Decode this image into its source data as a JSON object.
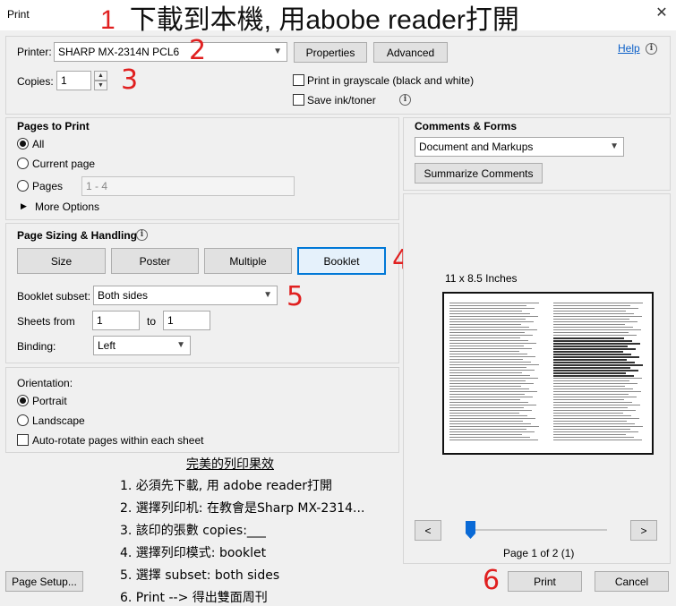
{
  "window": {
    "title": "Print",
    "close_glyph": "✕"
  },
  "annotations": {
    "header_number": "1",
    "header_text": "下載到本機, 用abobe reader打開",
    "n2": "2",
    "n3": "3",
    "n4": "4",
    "n5": "5",
    "n6": "6"
  },
  "printer": {
    "label": "Printer:",
    "selected": "SHARP MX-2314N PCL6",
    "properties_label": "Properties",
    "advanced_label": "Advanced",
    "help_label": "Help",
    "copies_label": "Copies:",
    "copies_value": "1",
    "grayscale_label": "Print in grayscale (black and white)",
    "save_ink_label": "Save ink/toner"
  },
  "pages_to_print": {
    "title": "Pages to Print",
    "all_label": "All",
    "current_label": "Current page",
    "pages_label": "Pages",
    "pages_value": "1 - 4",
    "more_options_label": "More Options"
  },
  "sizing": {
    "title": "Page Sizing & Handling",
    "tabs": [
      "Size",
      "Poster",
      "Multiple",
      "Booklet"
    ],
    "subset_label": "Booklet subset:",
    "subset_value": "Both sides",
    "sheets_label": "Sheets from",
    "sheets_from": "1",
    "to_label": "to",
    "sheets_to": "1",
    "binding_label": "Binding:",
    "binding_value": "Left"
  },
  "orientation": {
    "title": "Orientation:",
    "portrait_label": "Portrait",
    "landscape_label": "Landscape",
    "autorotate_label": "Auto-rotate pages within each sheet"
  },
  "comments": {
    "title": "Comments & Forms",
    "selected": "Document and Markups",
    "summarize_label": "Summarize Comments"
  },
  "preview": {
    "size_label": "11 x 8.5 Inches",
    "page_indicator": "Page 1 of 2 (1)",
    "prev_glyph": "<",
    "next_glyph": ">",
    "slider_fraction": 0.0
  },
  "instructions": {
    "title": "完美的列印果效",
    "steps": [
      "1. 必須先下載, 用 adobe reader打開",
      "2. 選擇列印机: 在教會是Sharp MX-2314...",
      "3. 該印的張數 copies:___",
      "4. 選擇列印模式: booklet",
      "5. 選擇 subset: both sides",
      "6. Print    -->    得出雙面周刊"
    ]
  },
  "footer": {
    "page_setup_label": "Page Setup...",
    "print_label": "Print",
    "cancel_label": "Cancel"
  }
}
